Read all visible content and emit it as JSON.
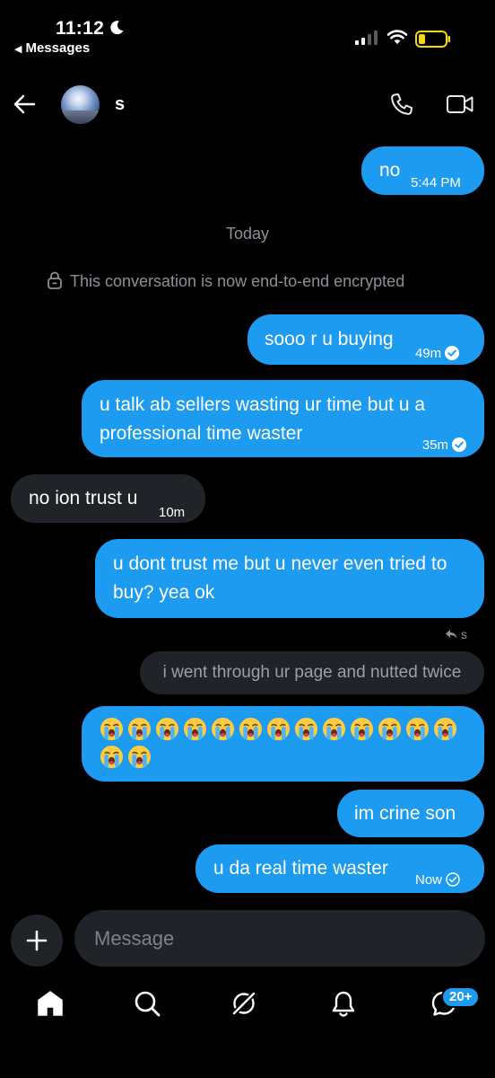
{
  "status_bar": {
    "time": "11:12",
    "back_label": "Messages",
    "battery_color": "#f5d90a"
  },
  "header": {
    "name": "s"
  },
  "conversation": {
    "day_label": "Today",
    "encryption_notice": "This conversation is now end-to-end encrypted",
    "messages": [
      {
        "direction": "out",
        "text": "no",
        "time": "5:44 PM"
      },
      {
        "direction": "out",
        "text": "sooo r u buying",
        "time": "49m",
        "status": "read"
      },
      {
        "direction": "out",
        "text": "u talk ab sellers wasting ur time but u a professional time waster",
        "time": "35m",
        "status": "read"
      },
      {
        "direction": "in",
        "text": "no ion trust u",
        "time": "10m"
      },
      {
        "direction": "out",
        "text": "u dont trust me but u never even tried to buy? yea ok"
      },
      {
        "direction": "out",
        "reply_to_author": "s",
        "quoted_text": "i went through ur page and nutted twice",
        "emoji": "loudly-crying-face",
        "emoji_count": 15
      },
      {
        "direction": "out",
        "text": "im crine son"
      },
      {
        "direction": "out",
        "text": "u da real time waster",
        "time": "Now",
        "status": "sent"
      }
    ]
  },
  "composer": {
    "placeholder": "Message"
  },
  "bottom_nav": {
    "items": [
      "home-icon",
      "search-icon",
      "grok-icon",
      "notifications-icon",
      "messages-icon"
    ],
    "messages_badge": "20+"
  },
  "colors": {
    "accent": "#1d9bf0",
    "incoming_bubble": "#202327",
    "background": "#000000"
  }
}
